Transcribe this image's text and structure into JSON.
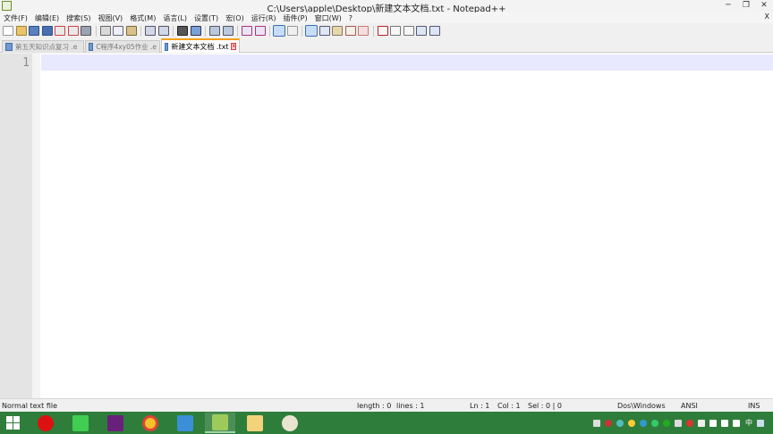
{
  "window": {
    "title": "C:\\Users\\apple\\Desktop\\新建文本文档.txt - Notepad++",
    "controls": [
      "─",
      "❐",
      "✕"
    ]
  },
  "menu": {
    "items": [
      "文件(F)",
      "编辑(E)",
      "搜索(S)",
      "视图(V)",
      "格式(M)",
      "语言(L)",
      "设置(T)",
      "宏(O)",
      "运行(R)",
      "插件(P)",
      "窗口(W)",
      "?"
    ],
    "close": "X"
  },
  "toolbar": {
    "icons": [
      "new-file-icon",
      "open-file-icon",
      "save-icon",
      "save-all-icon",
      "close-icon",
      "close-all-icon",
      "print-icon",
      "cut-icon",
      "copy-icon",
      "paste-icon",
      "undo-icon",
      "redo-icon",
      "find-icon",
      "replace-icon",
      "zoom-in-icon",
      "zoom-out-icon",
      "sync-v-icon",
      "sync-h-icon",
      "word-wrap-icon",
      "all-chars-icon",
      "indent-guide-icon",
      "doc-map-icon",
      "function-list-icon",
      "folder-as-workspace-icon",
      "monitor-icon",
      "record-macro-icon",
      "stop-macro-icon",
      "play-macro-icon",
      "run-macro-icon",
      "save-macro-icon"
    ]
  },
  "tabs": [
    {
      "label": "第五天知识点复习 .e",
      "active": false
    },
    {
      "label": "C程序4xy05作业 .e",
      "active": false
    },
    {
      "label": "新建文本文档 .txt",
      "active": true
    }
  ],
  "editor": {
    "line_numbers": [
      "1"
    ],
    "content": ""
  },
  "status": {
    "file_type": "Normal text file",
    "length": "length : 0",
    "lines": "lines : 1",
    "ln": "Ln : 1",
    "col": "Col : 1",
    "sel": "Sel : 0 | 0",
    "eol": "Dos\\Windows",
    "encoding": "ANSI",
    "mode": "INS"
  },
  "taskbar": {
    "apps": [
      "opera-icon",
      "qt-creator-icon",
      "visual-studio-icon",
      "chrome-icon",
      "wps-writer-icon",
      "notepad-plus-plus-icon",
      "file-explorer-icon",
      "paint-icon"
    ],
    "tray_lang": "中"
  },
  "colors": {
    "taskbar": "#2f7d3b",
    "current_line": "#e8e8ff",
    "tab_accent": "#f4a11b",
    "gutter": "#e4e4e4"
  }
}
